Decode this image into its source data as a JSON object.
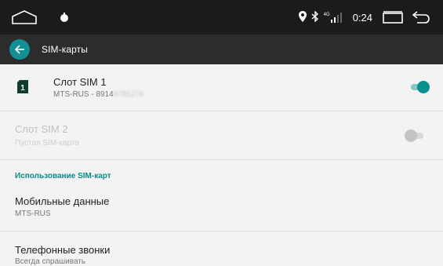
{
  "status_bar": {
    "time": "0:24",
    "network_label": "4G",
    "icons": [
      "home-icon",
      "notification-dot-icon",
      "location-icon",
      "bluetooth-icon",
      "signal-icon",
      "recents-icon",
      "back-nav-icon"
    ]
  },
  "app_bar": {
    "title": "SIM-карты",
    "back_icon": "arrow-left-icon"
  },
  "sim1": {
    "title": "Слот SIM 1",
    "subtitle_prefix": "MTS-RUS - 8914",
    "subtitle_masked": "6781276",
    "sim_badge": "1",
    "enabled": true
  },
  "sim2": {
    "title": "Слот SIM 2",
    "subtitle": "Пустая SIM-карта",
    "enabled": false
  },
  "usage_section": {
    "header": "Использование SIM-карт"
  },
  "mobile_data": {
    "title": "Мобильные данные",
    "subtitle": "MTS-RUS"
  },
  "phone_calls": {
    "title": "Телефонные звонки",
    "subtitle": "Всегда спрашивать"
  },
  "colors": {
    "accent": "#0a8e8f",
    "appbar": "#2c2c2c",
    "status_bar": "#1b1b1b",
    "background": "#f3f3f3"
  }
}
